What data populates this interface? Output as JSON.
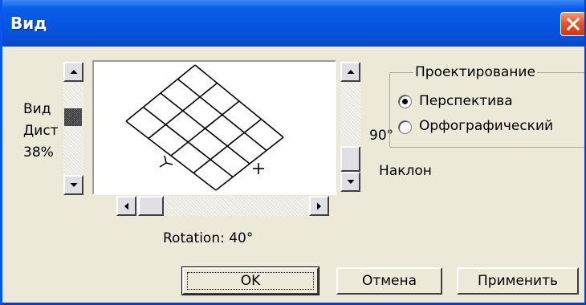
{
  "window": {
    "title": "Вид"
  },
  "view_distance": {
    "label_line1": "Вид",
    "label_line2": "Дист",
    "value_text": "38%"
  },
  "tilt": {
    "value_text": "90°",
    "label": "Наклон"
  },
  "rotation": {
    "value_text": "Rotation: 40°"
  },
  "projection": {
    "group_label": "Проектирование",
    "options": [
      {
        "label": "Перспектива",
        "selected": true
      },
      {
        "label": "Орфографический",
        "selected": false
      }
    ]
  },
  "buttons": {
    "ok": "OK",
    "cancel": "Отмена",
    "apply": "Применить"
  },
  "colors": {
    "titlebar": "#0655e0",
    "close_button": "#e2552f",
    "dialog_face": "#ece9d8"
  }
}
